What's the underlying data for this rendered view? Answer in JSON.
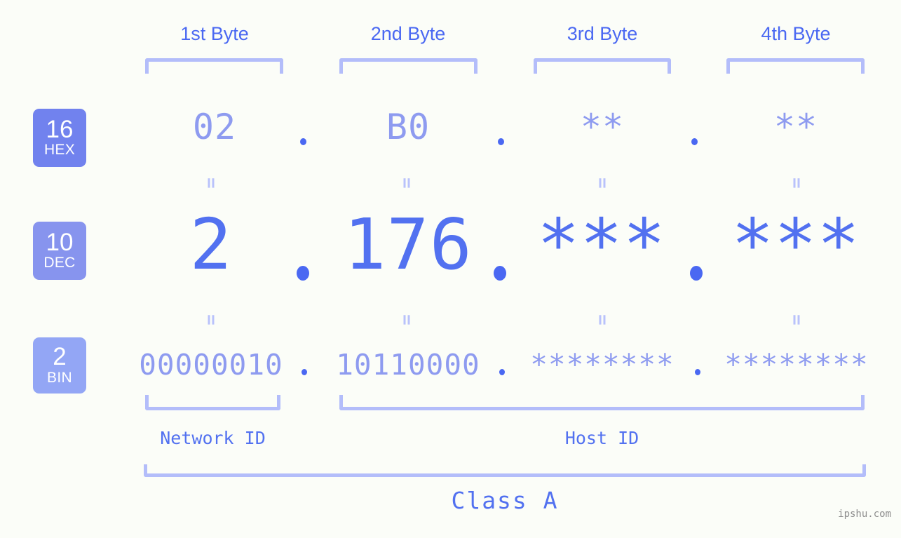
{
  "background_color": "#fbfdf8",
  "accent_color": "#5271f0",
  "muted_accent_color": "#8e9bf0",
  "bracket_color": "#b3bdfa",
  "headers": [
    {
      "label": "1st Byte"
    },
    {
      "label": "2nd Byte"
    },
    {
      "label": "3rd Byte"
    },
    {
      "label": "4th Byte"
    }
  ],
  "rows": [
    {
      "id": "hex",
      "badge": {
        "number": "16",
        "name": "HEX",
        "color": "#7182ee"
      },
      "values": [
        "02",
        "B0",
        "**",
        "**"
      ],
      "separator": "."
    },
    {
      "id": "dec",
      "badge": {
        "number": "10",
        "name": "DEC",
        "color": "#8794ee"
      },
      "values": [
        "2",
        "176",
        "***",
        "***"
      ],
      "separator": "."
    },
    {
      "id": "bin",
      "badge": {
        "number": "2",
        "name": "BIN",
        "color": "#93a6f5"
      },
      "values": [
        "00000010",
        "10110000",
        "********",
        "********"
      ],
      "separator": "."
    }
  ],
  "equality_mark": "=",
  "sections": [
    {
      "label": "Network ID"
    },
    {
      "label": "Host ID"
    }
  ],
  "class": {
    "label": "Class A"
  },
  "watermark": {
    "text": "ipshu.com"
  }
}
